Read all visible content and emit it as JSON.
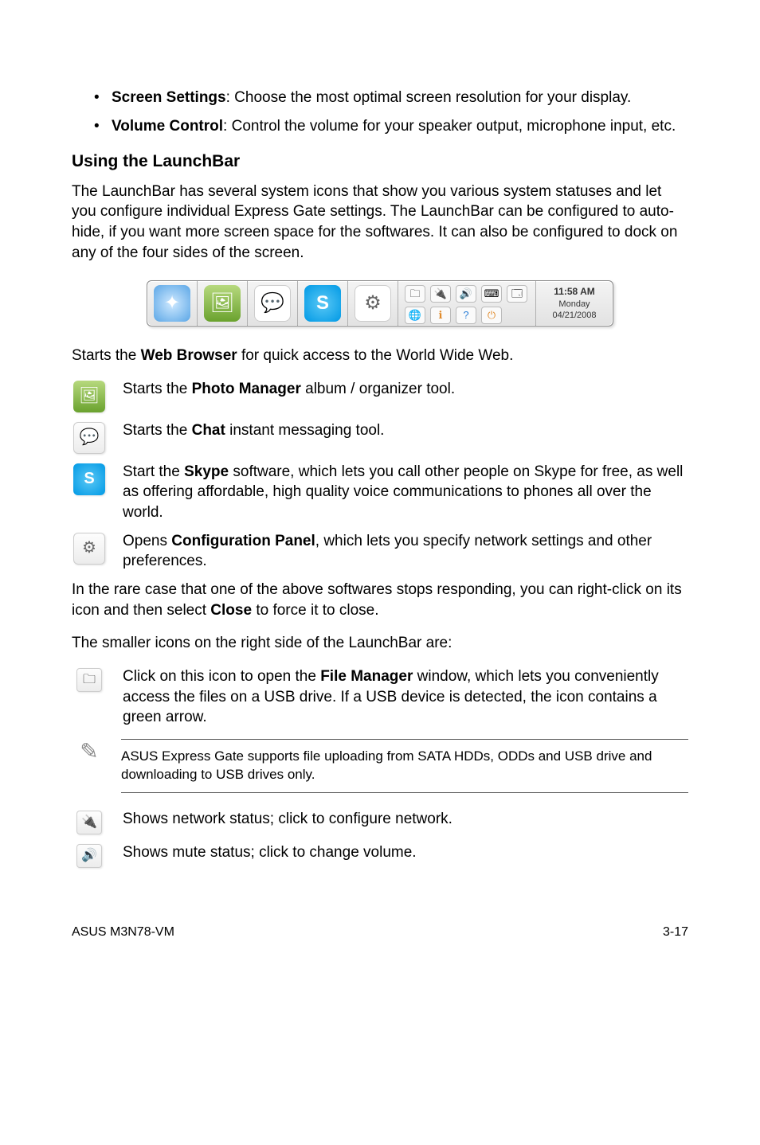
{
  "bullets": [
    {
      "label": "Screen Settings",
      "text": ": Choose the most optimal screen resolution for your display."
    },
    {
      "label": "Volume Control",
      "text": ": Control the volume for your speaker output, microphone input, etc."
    }
  ],
  "section_heading": "Using the LaunchBar",
  "intro_para": "The LaunchBar has several system icons that show you various system statuses and let you configure individual Express Gate settings. The LaunchBar can be configured to auto-hide, if you want more screen space for the softwares. It can also be configured to dock on any of the four sides of the screen.",
  "launchbar": {
    "time": "11:58 AM",
    "day": "Monday",
    "date": "04/21/2008"
  },
  "web_line_pre": "Starts the ",
  "web_line_bold": "Web Browser",
  "web_line_post": " for quick access to the World Wide Web.",
  "rows": {
    "photo_pre": "Starts the ",
    "photo_bold": "Photo Manager",
    "photo_post": " album / organizer tool.",
    "chat_pre": "Starts the ",
    "chat_bold": "Chat",
    "chat_post": " instant messaging tool.",
    "skype_pre": "Start the ",
    "skype_bold": "Skype",
    "skype_post": " software, which lets you call other people on Skype for free, as well as offering affordable, high quality voice communications to phones all over the world.",
    "config_pre": "Opens ",
    "config_bold": "Configuration Panel",
    "config_post": ", which lets you specify network settings and other preferences."
  },
  "mid_para_pre": "In the rare case that one of the above softwares stops responding, you can right-click on its icon and then select ",
  "mid_para_bold": "Close",
  "mid_para_post": " to force it to close.",
  "small_header": "The smaller icons on the right side of the LaunchBar are:",
  "file_mgr_pre": "Click on this icon to open the ",
  "file_mgr_bold": "File Manager",
  "file_mgr_post": " window, which lets you conveniently access the files on a USB drive. If a USB device is detected, the icon contains a green arrow.",
  "note_text": "ASUS Express Gate supports file uploading from SATA HDDs, ODDs and USB drive and downloading to USB drives only.",
  "network_text": "Shows network status; click to configure network.",
  "mute_text": "Shows mute status; click to change volume.",
  "footer_left": "ASUS M3N78-VM",
  "footer_right": "3-17"
}
